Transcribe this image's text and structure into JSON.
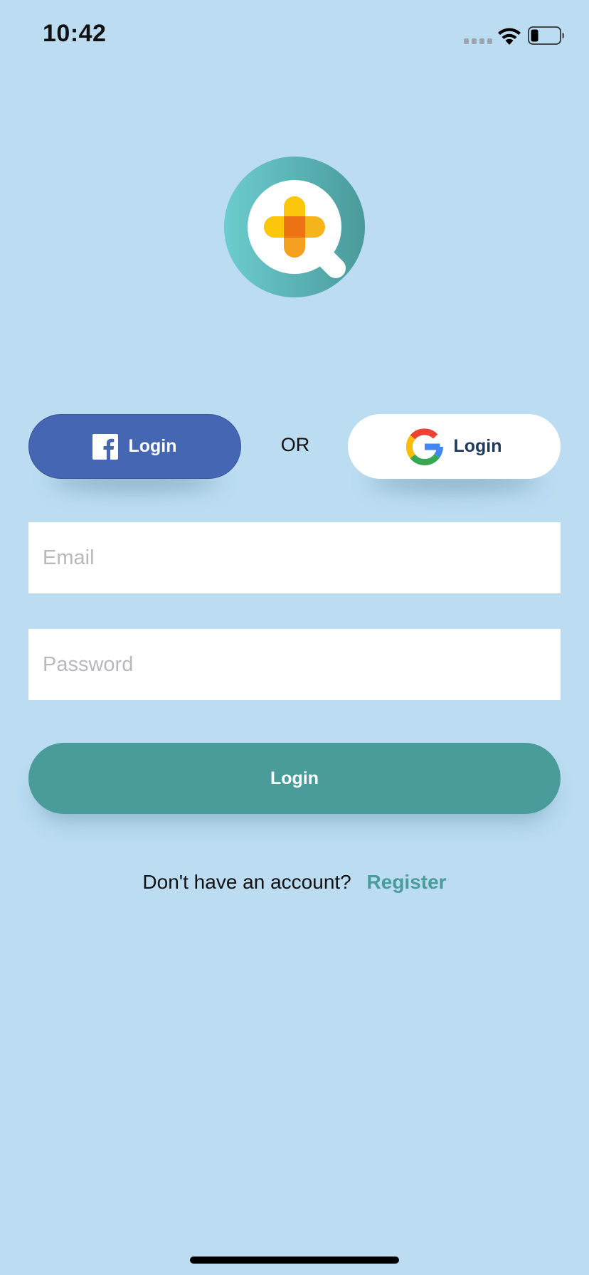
{
  "status_bar": {
    "time": "10:42"
  },
  "social_login": {
    "facebook_label": "Login",
    "facebook_color": "#4566b3",
    "google_label": "Login",
    "separator": "OR"
  },
  "form": {
    "email_placeholder": "Email",
    "email_value": "",
    "password_placeholder": "Password",
    "password_value": ""
  },
  "login_button": {
    "label": "Login",
    "color": "#4a9c9b"
  },
  "register": {
    "prompt": "Don't have an account?",
    "link_label": "Register"
  },
  "icons": {
    "logo": "health-search-logo",
    "facebook": "facebook-icon",
    "google": "google-icon",
    "wifi": "wifi-icon",
    "battery": "battery-icon",
    "signal": "cellular-signal-icon"
  },
  "theme": {
    "background": "#bbdcf1"
  }
}
